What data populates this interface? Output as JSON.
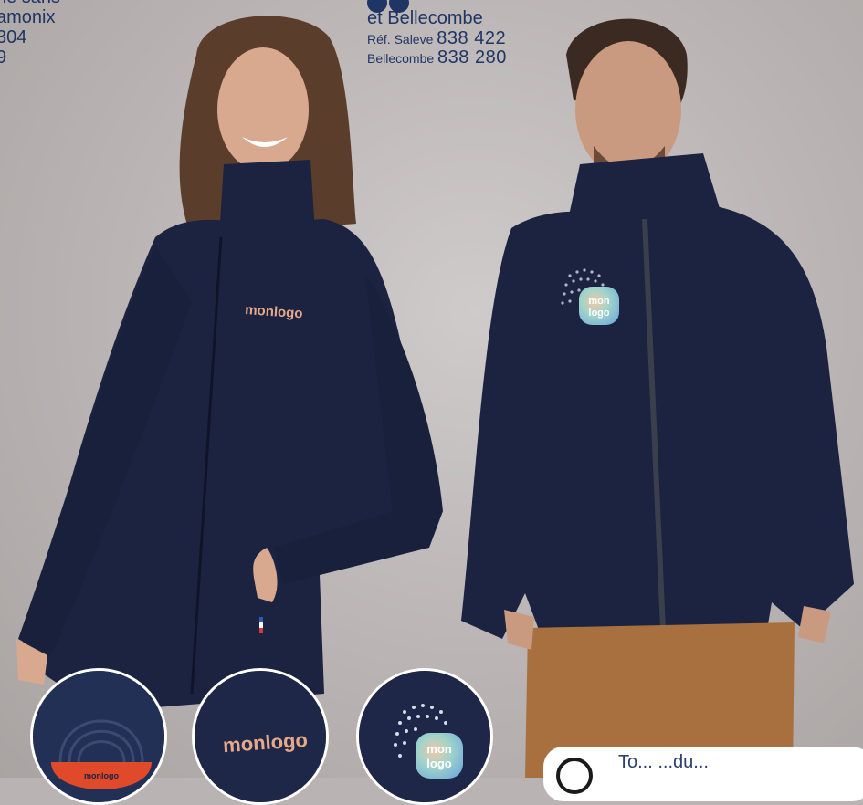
{
  "left_text": {
    "line1": "ne sans",
    "line2": "amonix",
    "line3": "304",
    "line4": "9"
  },
  "right_text": {
    "headline": "et Bellecombe",
    "ref1_label": "Réf. Saleve",
    "ref1_number": "838 422",
    "ref2_label": "Bellecombe",
    "ref2_number": "838 280"
  },
  "logos": {
    "woman_chest": "monlogo",
    "man_chest_line1": "mon",
    "man_chest_line2": "logo",
    "circle1": "monlogo",
    "circle2": "monlogo",
    "circle3_line1": "mon",
    "circle3_line2": "logo"
  },
  "tag": {
    "text": "To... ...du..."
  },
  "colors": {
    "brand_blue": "#1f3566",
    "jacket_navy": "#1b2340",
    "logo_peach": "#e8a98a",
    "trousers": "#a8703f"
  }
}
